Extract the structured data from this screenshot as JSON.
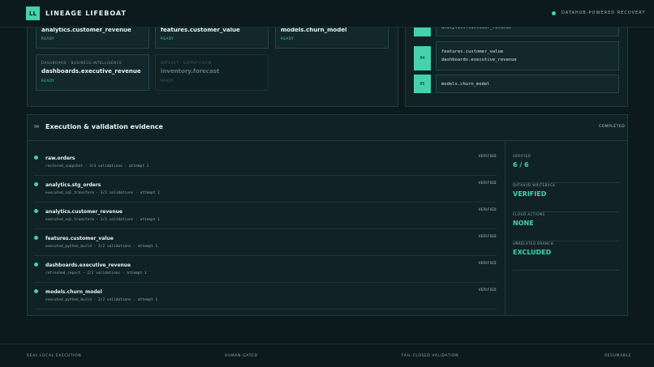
{
  "header": {
    "logo": "LL",
    "title": "LINEAGE LIFEBOAT",
    "status": "DATAHUB-POWERED RECOVERY"
  },
  "asset_cards": [
    {
      "meta": "",
      "name": "analytics.customer_revenue",
      "status": "READY"
    },
    {
      "meta": "",
      "name": "features.customer_value",
      "status": "READY"
    },
    {
      "meta": "",
      "name": "models.churn_model",
      "status": "READY"
    },
    {
      "meta": "DASHBOARD · BUSINESS-INTELLIGENCE",
      "name": "dashboards.executive_revenue",
      "status": "READY"
    },
    {
      "meta": "DATASET · SUPPLY-CHAIN",
      "name": "inventory.forecast",
      "status": "READY"
    }
  ],
  "steps": [
    {
      "num": "",
      "lines": [
        "analytics.customer_revenue"
      ]
    },
    {
      "num": "04",
      "lines": [
        "features.customer_value",
        "dashboards.executive_revenue"
      ]
    },
    {
      "num": "05",
      "lines": [
        "models.churn_model"
      ]
    }
  ],
  "evidence": {
    "num": "04",
    "title": "Execution & validation evidence",
    "status": "COMPLETED",
    "rows": [
      {
        "name": "raw.orders",
        "detail": "restored_snapshot · 3/3 validations · attempt 1",
        "status": "VERIFIED"
      },
      {
        "name": "analytics.stg_orders",
        "detail": "executed_sql_transform · 3/3 validations · attempt 1",
        "status": "VERIFIED"
      },
      {
        "name": "analytics.customer_revenue",
        "detail": "executed_sql_transform · 3/3 validations · attempt 1",
        "status": "VERIFIED"
      },
      {
        "name": "features.customer_value",
        "detail": "executed_python_build · 2/2 validations · attempt 1",
        "status": "VERIFIED"
      },
      {
        "name": "dashboards.executive_revenue",
        "detail": "refreshed_report · 2/2 validations · attempt 1",
        "status": "VERIFIED"
      },
      {
        "name": "models.churn_model",
        "detail": "executed_python_build · 2/2 validations · attempt 1",
        "status": "VERIFIED"
      }
    ],
    "summary": [
      {
        "label": "VERIFIED",
        "value": "6 / 6"
      },
      {
        "label": "DATAHUB WRITEBACK",
        "value": "VERIFIED"
      },
      {
        "label": "CLOUD ACTIONS",
        "value": "NONE"
      },
      {
        "label": "UNRELATED BRANCH",
        "value": "EXCLUDED"
      }
    ]
  },
  "footer": [
    "REAL LOCAL EXECUTION",
    "HUMAN-GATED",
    "FAIL-CLOSED VALIDATION",
    "RESUMABLE"
  ],
  "colors": {
    "accent": "#45d1ad",
    "background": "#0c1a1e",
    "panel": "#102226"
  }
}
